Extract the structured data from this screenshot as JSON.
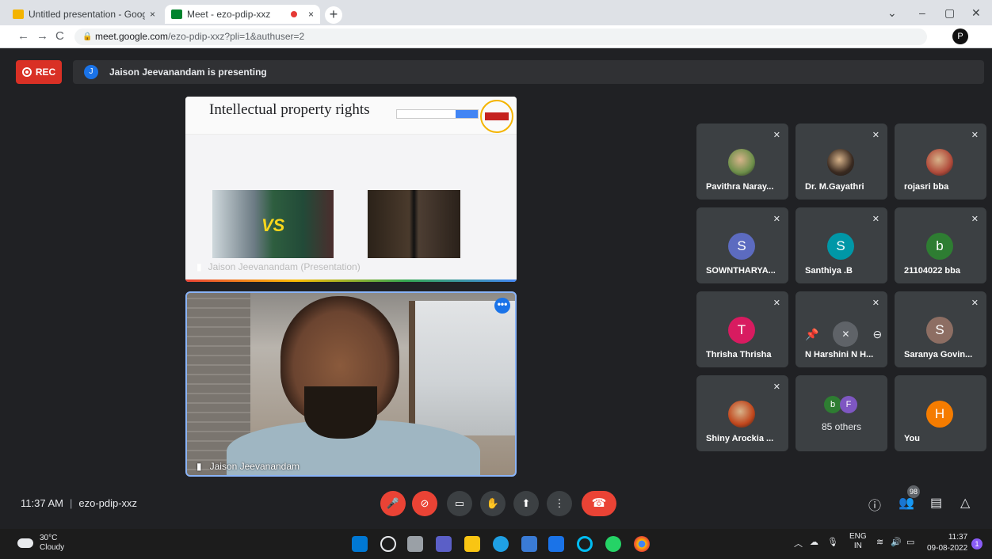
{
  "browser": {
    "tabs": [
      {
        "label": "Untitled presentation - Google S",
        "close": "×",
        "icon_color": "#f4b400"
      },
      {
        "label": "Meet - ezo-pdip-xxz",
        "close": "×",
        "icon_color": "#00832d"
      }
    ],
    "new_tab": "+",
    "window_controls": [
      "⌄",
      "–",
      "▢",
      "✕"
    ],
    "url_host": "meet.google.com",
    "url_path": "/ezo-pdip-xxz?pli=1&authuser=2",
    "profile_initial": "P"
  },
  "meet": {
    "rec_label": "REC",
    "presenter_initial": "J",
    "presenting_text": "Jaison Jeevanandam is presenting",
    "slide": {
      "title": "Intellectual property rights",
      "vs_text": "VS",
      "caption": "Jaison Jeevanandam (Presentation)"
    },
    "camera_caption": "Jaison Jeevanandam",
    "more_glyph": "•••",
    "participants": [
      {
        "name": "Pavithra Naray...",
        "type": "photo",
        "color": "#6d8f4a"
      },
      {
        "name": "Dr. M.Gayathri",
        "type": "photo",
        "color": "#3a2a20"
      },
      {
        "name": "rojasri bba",
        "type": "photo",
        "color": "#b04a3a"
      },
      {
        "name": "SOWNTHARYA...",
        "initial": "S",
        "color": "#5c6bc0"
      },
      {
        "name": "Santhiya .B",
        "initial": "S",
        "color": "#0097a7"
      },
      {
        "name": "21104022 bba",
        "initial": "b",
        "color": "#2e7d32"
      },
      {
        "name": "Thrisha Thrisha",
        "initial": "T",
        "color": "#d81b60"
      },
      {
        "name": "N Harshini N H...",
        "type": "hover"
      },
      {
        "name": "Saranya Govin...",
        "initial": "S",
        "color": "#8d6e63"
      },
      {
        "name": "Shiny Arockia ...",
        "type": "photo",
        "color": "#c0461c"
      },
      {
        "name": "85 others",
        "type": "others",
        "initials": [
          "b",
          "F"
        ],
        "colors": [
          "#2e7d32",
          "#7e57c2"
        ]
      },
      {
        "name": "You",
        "initial": "H",
        "color": "#f57c00"
      }
    ],
    "time": "11:37 AM",
    "meeting_code": "ezo-pdip-xxz",
    "participant_count": "98"
  },
  "taskbar": {
    "temperature": "30°C",
    "weather": "Cloudy",
    "lang": "ENG",
    "region": "IN",
    "clock_time": "11:37",
    "clock_date": "09-08-2022",
    "notif_count": "1"
  }
}
